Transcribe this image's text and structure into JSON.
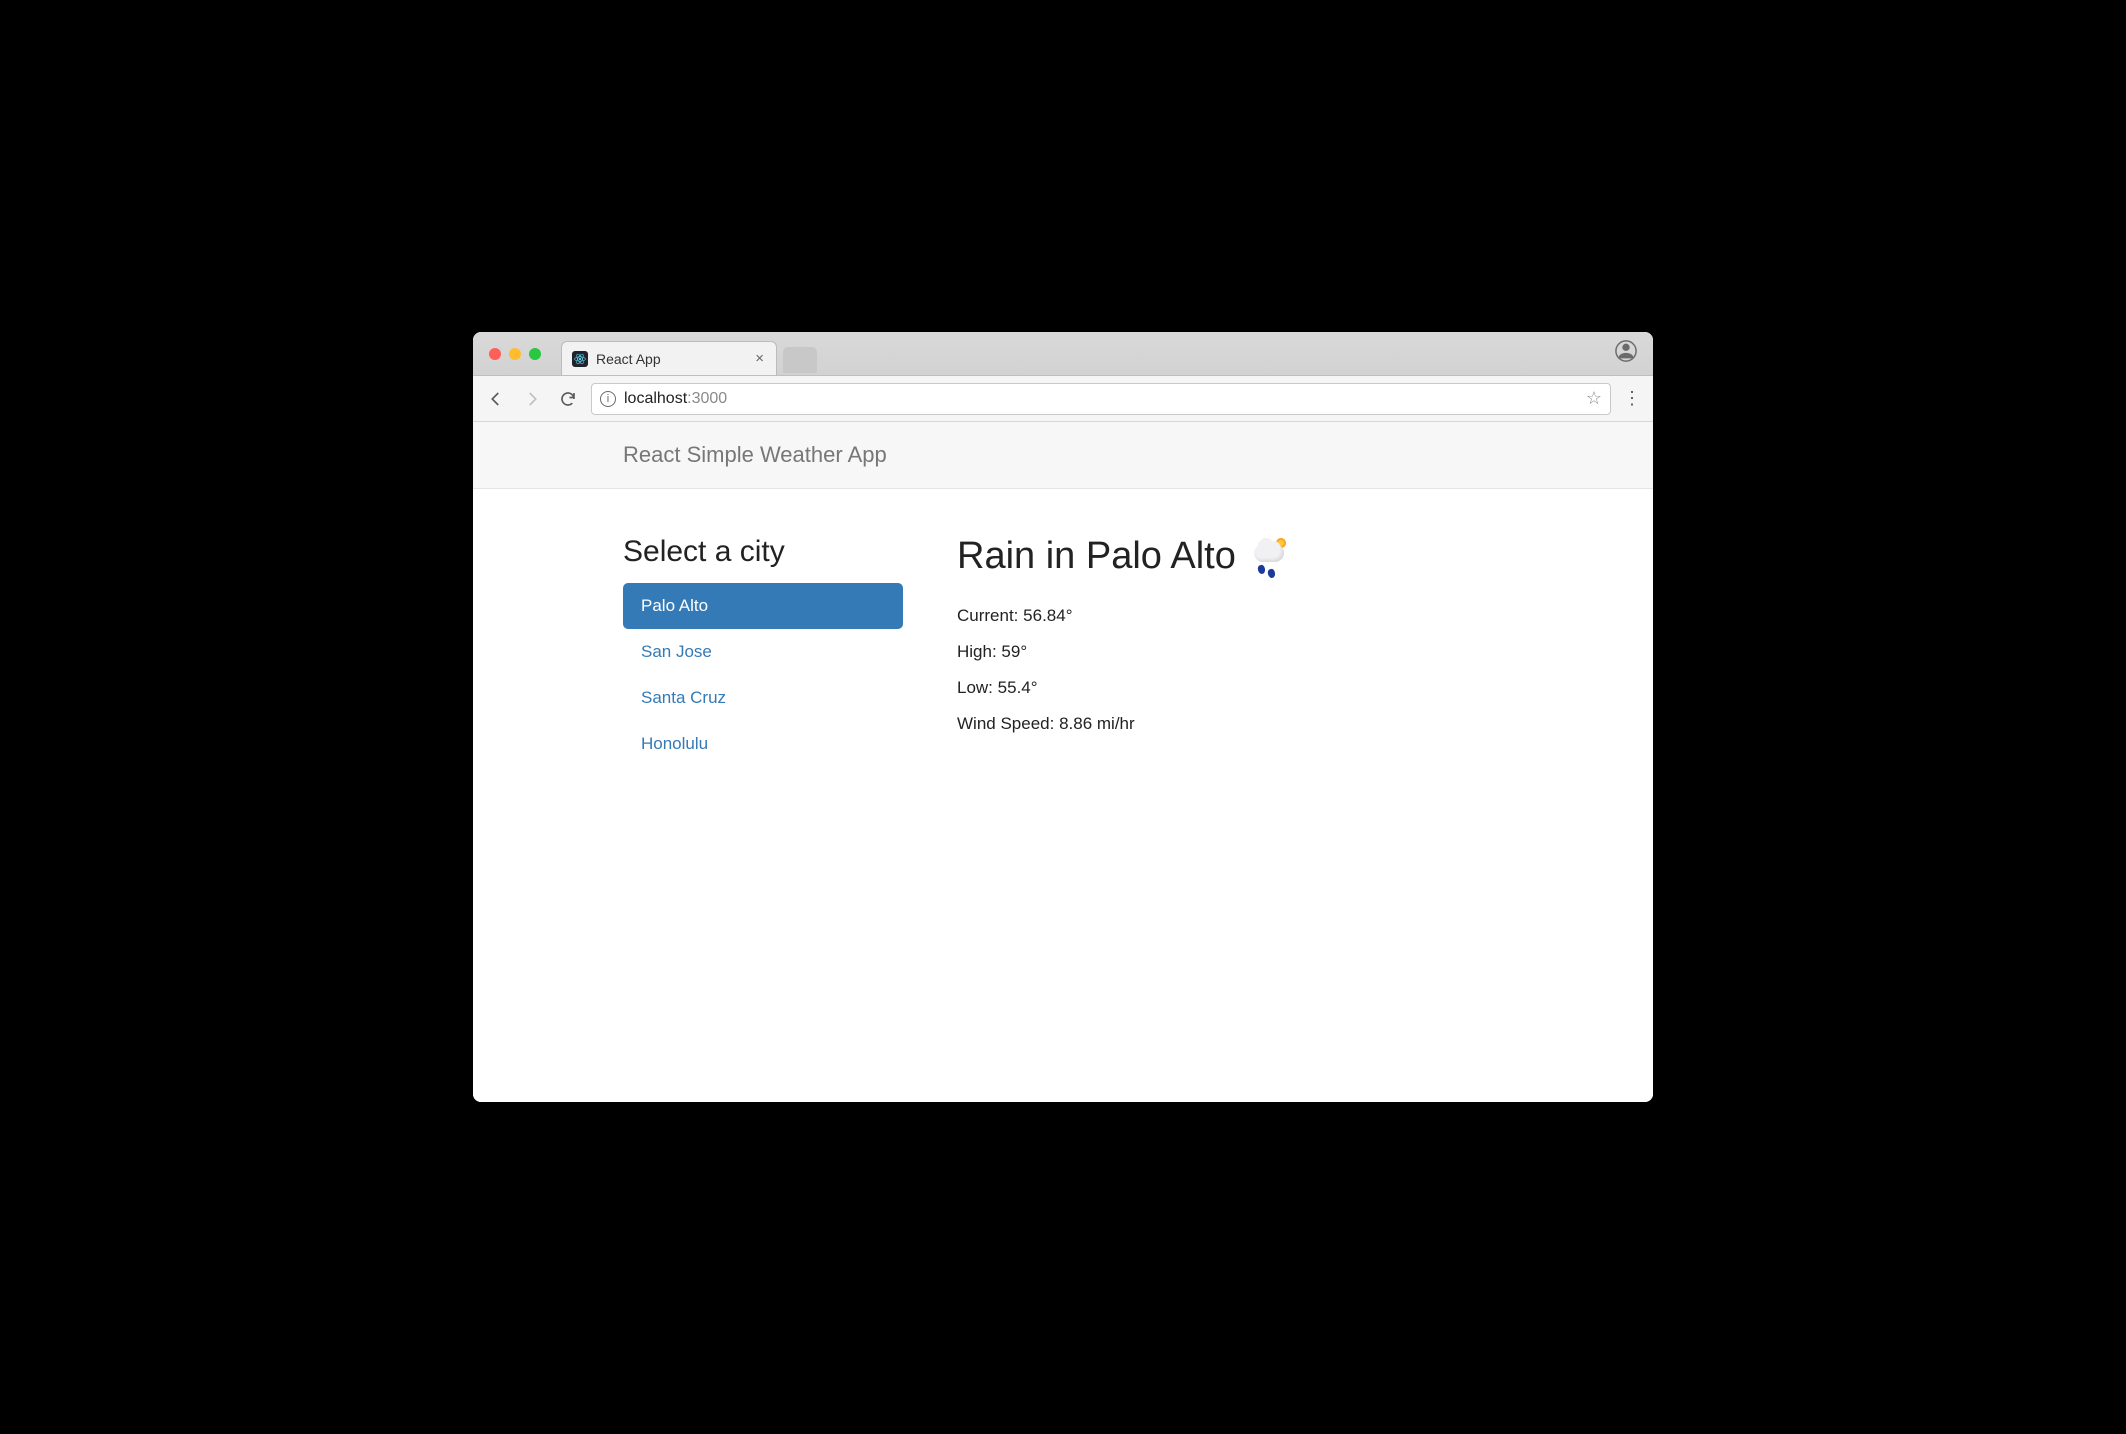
{
  "browser": {
    "tab_title": "React App",
    "url_host": "localhost",
    "url_port": ":3000",
    "info_glyph": "i",
    "star_glyph": "☆",
    "kebab_glyph": "⋮",
    "close_glyph": "×"
  },
  "header": {
    "title": "React Simple Weather App"
  },
  "sidebar": {
    "heading": "Select a city",
    "cities": [
      {
        "name": "Palo Alto",
        "active": true
      },
      {
        "name": "San Jose",
        "active": false
      },
      {
        "name": "Santa Cruz",
        "active": false
      },
      {
        "name": "Honolulu",
        "active": false
      }
    ]
  },
  "detail": {
    "headline": "Rain in Palo Alto",
    "stats": {
      "current_label": "Current:",
      "current_value": "56.84°",
      "high_label": "High:",
      "high_value": "59°",
      "low_label": "Low:",
      "low_value": "55.4°",
      "wind_label": "Wind Speed:",
      "wind_value": "8.86 mi/hr"
    }
  }
}
